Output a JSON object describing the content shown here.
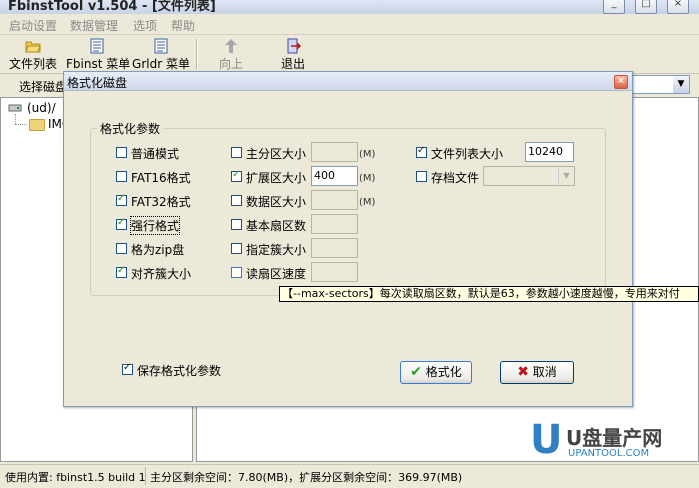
{
  "window": {
    "title": "FbinstTool v1.504 - [文件列表]",
    "min": "_",
    "max": "□",
    "close": "×"
  },
  "menu": [
    "启动设置",
    "数据管理",
    "选项",
    "帮助"
  ],
  "toolbar": {
    "file_list": "文件列表",
    "fbinst_menu": "Fbinst 菜单",
    "grldr_menu": "Grldr 菜单",
    "up": "向上",
    "exit": "退出"
  },
  "selectbar": {
    "label": "选择磁盘"
  },
  "tree": {
    "root": "(ud)/",
    "child": "IMG"
  },
  "status": {
    "version": "使用内置: fbinst1.5 build 1",
    "space": "主分区剩余空间：7.80(MB)，扩展分区剩余空间：369.97(MB)"
  },
  "dialog": {
    "title": "格式化磁盘",
    "close": "×",
    "group_label": "格式化参数",
    "col1": [
      {
        "label": "普通模式",
        "checked": false
      },
      {
        "label": "FAT16格式",
        "checked": false
      },
      {
        "label": "FAT32格式",
        "checked": true
      },
      {
        "label": "强行格式",
        "checked": true
      },
      {
        "label": "格为zip盘",
        "checked": false
      },
      {
        "label": "对齐簇大小",
        "checked": true
      }
    ],
    "col2": [
      {
        "label": "主分区大小",
        "checked": false,
        "value": "",
        "unit": "(M)"
      },
      {
        "label": "扩展区大小",
        "checked": true,
        "value": "400",
        "unit": "(M)"
      },
      {
        "label": "数据区大小",
        "checked": false,
        "value": "",
        "unit": "(M)"
      },
      {
        "label": "基本扇区数",
        "checked": false,
        "value": ""
      },
      {
        "label": "指定簇大小",
        "checked": false,
        "value": ""
      },
      {
        "label": "读扇区速度",
        "checked": false,
        "value": ""
      }
    ],
    "col3": [
      {
        "label": "文件列表大小",
        "checked": true,
        "value": "10240"
      },
      {
        "label": "存档文件",
        "checked": false,
        "value": ""
      }
    ],
    "save_params": "保存格式化参数",
    "format_button": "格式化",
    "cancel_button": "取消"
  },
  "tooltip": "【--max-sectors】每次读取扇区数，默认是63，参数越小速度越慢，专用来对付",
  "watermark": {
    "text": "U盘量产网",
    "url": "UPANTOOL.COM"
  },
  "colors": {
    "check_green": "#21a121",
    "cancel_red": "#c0101a",
    "tooltip_bg": "#ffffe1"
  }
}
